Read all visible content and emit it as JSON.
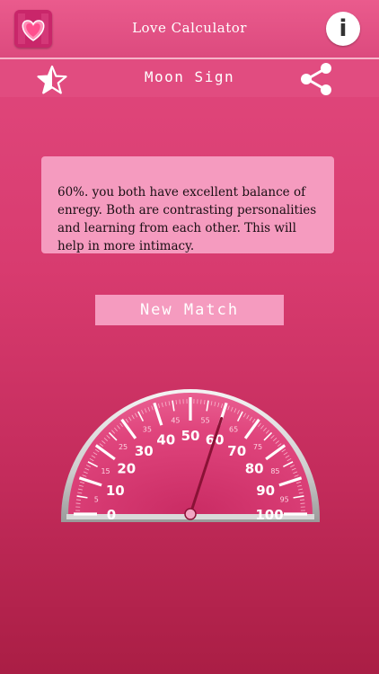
{
  "header": {
    "title": "Love Calculator",
    "info_label": "i"
  },
  "subheader": {
    "title": "Moon Sign"
  },
  "result": {
    "text": "60%. you both have excellent balance of enregy. Both are contrasting personalities and learning from each other. This will help in more intimacy."
  },
  "actions": {
    "new_match_label": "New Match"
  },
  "gauge": {
    "value": 60,
    "min": 0,
    "max": 100,
    "major_ticks": [
      "0",
      "10",
      "20",
      "30",
      "40",
      "50",
      "60",
      "70",
      "80",
      "90",
      "100"
    ],
    "minor_ticks": [
      "5",
      "15",
      "25",
      "35",
      "45",
      "55",
      "65",
      "75",
      "85",
      "95"
    ]
  },
  "colors": {
    "accent": "#e14c80",
    "box": "#f59bbf",
    "gauge_face": "#e0457d",
    "needle": "#8a1236"
  }
}
